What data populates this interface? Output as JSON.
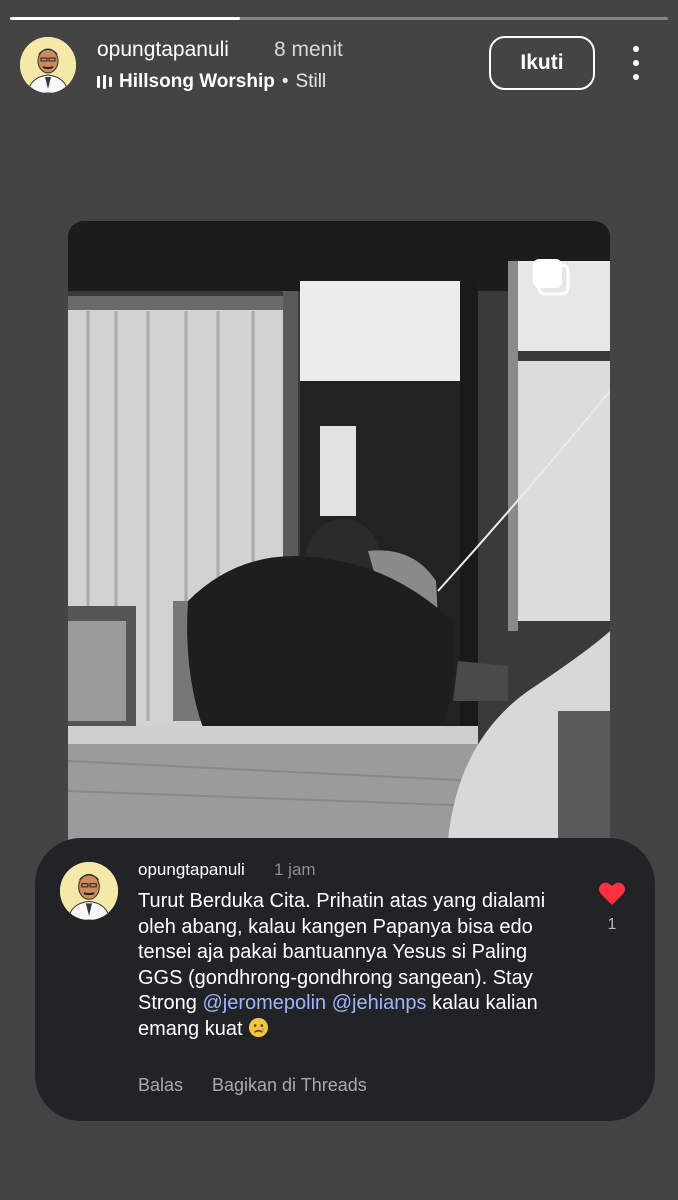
{
  "story": {
    "progress": 0.35
  },
  "header": {
    "username": "opungtapanuli",
    "time": "8 menit",
    "music_artist": "Hillsong Worship",
    "music_separator": "•",
    "music_song": "Still",
    "follow_label": "Ikuti"
  },
  "comment": {
    "username": "opungtapanuli",
    "time": "1 jam",
    "text_part1": "Turut Berduka Cita. Prihatin atas yang dialami oleh abang, kalau kangen Papanya bisa edo tensei aja pakai bantuannya Yesus si Paling GGS (gondhrong-gondhrong sangean). Stay Strong ",
    "mention1": "@jeromepolin",
    "mention2": "@jehianps",
    "text_part2": " kalau kalian emang kuat ",
    "emoji": "crying-face",
    "likes": "1",
    "reply_label": "Balas",
    "share_label": "Bagikan di Threads"
  },
  "icons": {
    "music": "music-bars-icon",
    "more": "more-vertical-icon",
    "multi": "multiple-posts-icon",
    "heart": "heart-icon"
  },
  "colors": {
    "background": "#444444",
    "card": "#212327",
    "mention": "#9fb5ff",
    "heart": "#ff3040",
    "avatar_bg": "#f4e9a8"
  }
}
